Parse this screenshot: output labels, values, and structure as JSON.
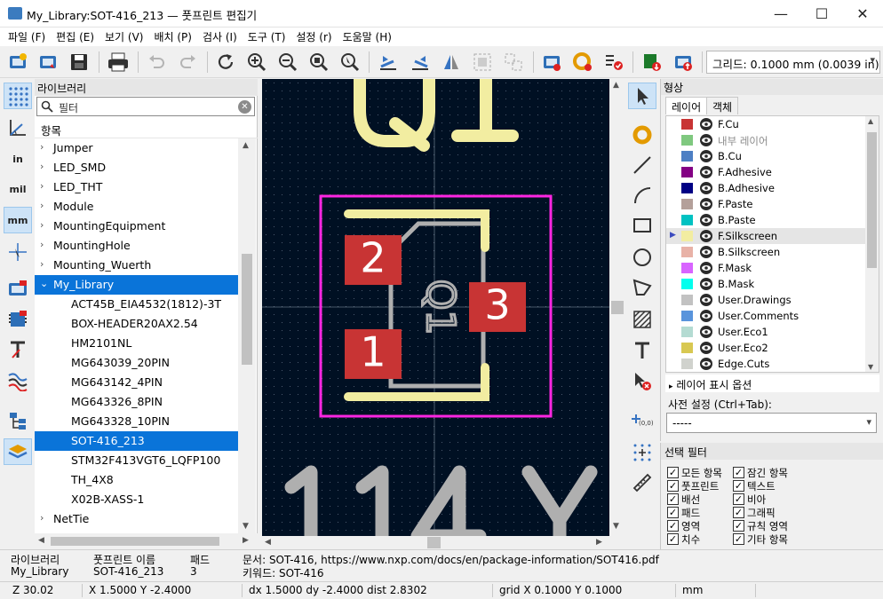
{
  "window": {
    "title": "My_Library:SOT-416_213 — 풋프린트 편집기",
    "minimize": "—",
    "maximize": "☐",
    "close": "✕"
  },
  "menu": {
    "items": [
      "파일 (F)",
      "편집 (E)",
      "보기 (V)",
      "배치 (P)",
      "검사 (I)",
      "도구 (T)",
      "설정 (r)",
      "도움말 (H)"
    ]
  },
  "toolbar": {
    "grid_value": "그리드: 0.1000 mm (0.0039 in)"
  },
  "left_toolbar": {
    "in_label": "in",
    "mil_label": "mil",
    "mm_label": "mm"
  },
  "library": {
    "header": "라이브러리",
    "search_placeholder": "필터",
    "column_header": "항목",
    "items": [
      {
        "label": "Jumper",
        "expandable": true
      },
      {
        "label": "LED_SMD",
        "expandable": true
      },
      {
        "label": "LED_THT",
        "expandable": true
      },
      {
        "label": "Module",
        "expandable": true
      },
      {
        "label": "MountingEquipment",
        "expandable": true
      },
      {
        "label": "MountingHole",
        "expandable": true
      },
      {
        "label": "Mounting_Wuerth",
        "expandable": true
      },
      {
        "label": "My_Library",
        "expandable": true,
        "expanded": true,
        "selected": true
      },
      {
        "label": "ACT45B_EIA4532(1812)-3T",
        "child": true
      },
      {
        "label": "BOX-HEADER20AX2.54",
        "child": true
      },
      {
        "label": "HM2101NL",
        "child": true
      },
      {
        "label": "MG643039_20PIN",
        "child": true
      },
      {
        "label": "MG643142_4PIN",
        "child": true
      },
      {
        "label": "MG643326_8PIN",
        "child": true
      },
      {
        "label": "MG643328_10PIN",
        "child": true
      },
      {
        "label": "SOT-416_213",
        "child": true,
        "selected": true
      },
      {
        "label": "STM32F413VGT6_LQFP100",
        "child": true
      },
      {
        "label": "TH_4X8",
        "child": true
      },
      {
        "label": "X02B-XASS-1",
        "child": true
      },
      {
        "label": "NetTie",
        "expandable": true
      }
    ]
  },
  "canvas": {
    "ref_text": "Q1",
    "value_text": "114Y",
    "fab_ref": "Q1",
    "pads": [
      "1",
      "2",
      "3"
    ],
    "colors": {
      "background": "#001023",
      "silkscreen": "#f2eda1",
      "courtyard": "#ff26e2",
      "fab": "#afafaf",
      "pad": "#c83434",
      "pad_text": "#ffffff"
    }
  },
  "appearance": {
    "header": "형상",
    "tabs": [
      "레이어",
      "객체"
    ],
    "layers": [
      {
        "name": "F.Cu",
        "color": "#c83434"
      },
      {
        "name": "내부 레이어",
        "color": "#7fc87f",
        "dim": true
      },
      {
        "name": "B.Cu",
        "color": "#4d7fc4"
      },
      {
        "name": "F.Adhesive",
        "color": "#840084"
      },
      {
        "name": "B.Adhesive",
        "color": "#000084"
      },
      {
        "name": "F.Paste",
        "color": "#b4a09a"
      },
      {
        "name": "B.Paste",
        "color": "#00c2c2"
      },
      {
        "name": "F.Silkscreen",
        "color": "#f2eda1",
        "current": true
      },
      {
        "name": "B.Silkscreen",
        "color": "#e8b2a7"
      },
      {
        "name": "F.Mask",
        "color": "#d864ff"
      },
      {
        "name": "B.Mask",
        "color": "#02ffee"
      },
      {
        "name": "User.Drawings",
        "color": "#c2c2c2"
      },
      {
        "name": "User.Comments",
        "color": "#5994dc"
      },
      {
        "name": "User.Eco1",
        "color": "#b4dbd2"
      },
      {
        "name": "User.Eco2",
        "color": "#d8c852"
      },
      {
        "name": "Edge.Cuts",
        "color": "#d0d2cd"
      }
    ],
    "layer_options": "레이어 표시 옵션",
    "preset_label": "사전 설정 (Ctrl+Tab):",
    "preset_value": "-----"
  },
  "selection_filter": {
    "header": "선택 필터",
    "items": [
      {
        "label": "모든 항목",
        "checked": true
      },
      {
        "label": "잠긴 항목",
        "checked": true
      },
      {
        "label": "풋프린트",
        "checked": true
      },
      {
        "label": "텍스트",
        "checked": true
      },
      {
        "label": "배선",
        "checked": true
      },
      {
        "label": "비아",
        "checked": true
      },
      {
        "label": "패드",
        "checked": true
      },
      {
        "label": "그래픽",
        "checked": true
      },
      {
        "label": "영역",
        "checked": true
      },
      {
        "label": "규칙 영역",
        "checked": true
      },
      {
        "label": "치수",
        "checked": true
      },
      {
        "label": "기타 항목",
        "checked": true
      }
    ]
  },
  "message_panel": {
    "lib_label": "라이브러리",
    "lib_value": "My_Library",
    "fp_label": "풋프린트 이름",
    "fp_value": "SOT-416_213",
    "pads_label": "패드",
    "pads_value": "3",
    "doc_text": "문서: SOT-416, https://www.nxp.com/docs/en/package-information/SOT416.pdf",
    "kw_text": "키워드: SOT-416"
  },
  "status": {
    "zoom": "Z 30.02",
    "xy": "X 1.5000  Y -2.4000",
    "delta": "dx 1.5000  dy -2.4000  dist 2.8302",
    "grid": "grid X 0.1000  Y 0.1000",
    "units": "mm"
  }
}
